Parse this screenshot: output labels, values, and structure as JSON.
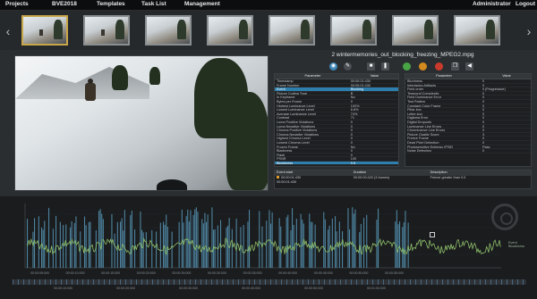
{
  "menu": {
    "projects": "Projects",
    "bve": "BVE2018",
    "templates": "Templates",
    "tasklist": "Task List",
    "management": "Management",
    "user": "Administrator",
    "logout": "Logout"
  },
  "player": {
    "filename": "2 wintermemories_out_blocking_freezing_MPEG2.mpg"
  },
  "left_table": {
    "col1": "Parameter",
    "col2": "Value",
    "rows": [
      [
        "Timestamp",
        "00:00:01:430"
      ],
      [
        "Frame Number",
        "00:00:01:430"
      ],
      [
        "Event",
        "Blocking"
      ],
      [
        "Picture Coding Type",
        "B"
      ],
      [
        "In Keyframe",
        "No"
      ],
      [
        "Bytes per Frame",
        "0"
      ],
      [
        "Highest Luminance Level",
        "100%"
      ],
      [
        "Lowest Luminance Level",
        "6.8%"
      ],
      [
        "Average Luminance Level",
        "74%"
      ],
      [
        "Contrast",
        "71"
      ],
      [
        "Luma Positive Violations",
        "0"
      ],
      [
        "Luma Negative Violations",
        "0"
      ],
      [
        "Chroma Positive Violations",
        "0"
      ],
      [
        "Chroma Negative Violations",
        "0"
      ],
      [
        "Highest Chroma Level",
        "0"
      ],
      [
        "Lowest Chroma Level",
        "0"
      ],
      [
        "Frozen Frame",
        "No"
      ],
      [
        "Blackness",
        "0"
      ],
      [
        "Flash",
        "0"
      ],
      [
        "PSNR",
        "100"
      ],
      [
        "Blockiness",
        "0.5"
      ]
    ]
  },
  "right_table": {
    "col1": "Parameter",
    "col2": "Value",
    "rows": [
      [
        "Blurriness",
        "0"
      ],
      [
        "Interlacing Artifacts",
        "0"
      ],
      [
        "Field order",
        "0 (Progressive)"
      ],
      [
        "Temporal Complexity",
        "0"
      ],
      [
        "Field Dominance Error",
        "0"
      ],
      [
        "Test Pattern",
        "0"
      ],
      [
        "Constant Color Frame",
        "0"
      ],
      [
        "Pillar-box",
        "0"
      ],
      [
        "Letter-box",
        "0"
      ],
      [
        "Digitaria Error",
        "0"
      ],
      [
        "Digital Dropouts",
        "0"
      ],
      [
        "Luminance Line Errors",
        "0"
      ],
      [
        "Chrominance Line Errors",
        "0"
      ],
      [
        "Picture Quality Score",
        "3"
      ],
      [
        "Freeze Frame",
        "0"
      ],
      [
        "Dead Pixel Detection",
        "0"
      ],
      [
        "Photosensitive Epilepsy (PSE)",
        "Pass"
      ],
      [
        "Noise Detection",
        "0"
      ]
    ]
  },
  "events": {
    "col1": "Event start",
    "col2": "Duration",
    "col3": "Description",
    "rows": [
      [
        "00:00:01:430",
        "00:00:00:420 (3 frames)",
        "Freeze greater than 0.0"
      ],
      [
        "00:00:01:430",
        "",
        ""
      ]
    ]
  },
  "graph": {
    "legend": [
      "Event",
      "Blockiness"
    ],
    "ticks": [
      "00:00:05:000",
      "00:00:10:000",
      "00:00:15:000",
      "00:00:20:000",
      "00:00:25:000",
      "00:00:30:000",
      "00:00:35:000",
      "00:00:40:000",
      "00:00:45:000",
      "00:00:50:000",
      "00:00:55:000"
    ],
    "scrub_ticks": [
      "00:00:10:000",
      "00:00:20:000",
      "00:00:30:000",
      "00:00:40:000",
      "00:00:50:000",
      "00:01:00:000"
    ]
  },
  "colors": {
    "event_bar": "#5fa6c9",
    "blockiness_line": "#8fbf6a",
    "selected_row": "#2e7fae",
    "active_thumb": "#c8a64a"
  },
  "icons": {
    "prev": "chevron-left-icon",
    "next": "chevron-right-icon"
  }
}
